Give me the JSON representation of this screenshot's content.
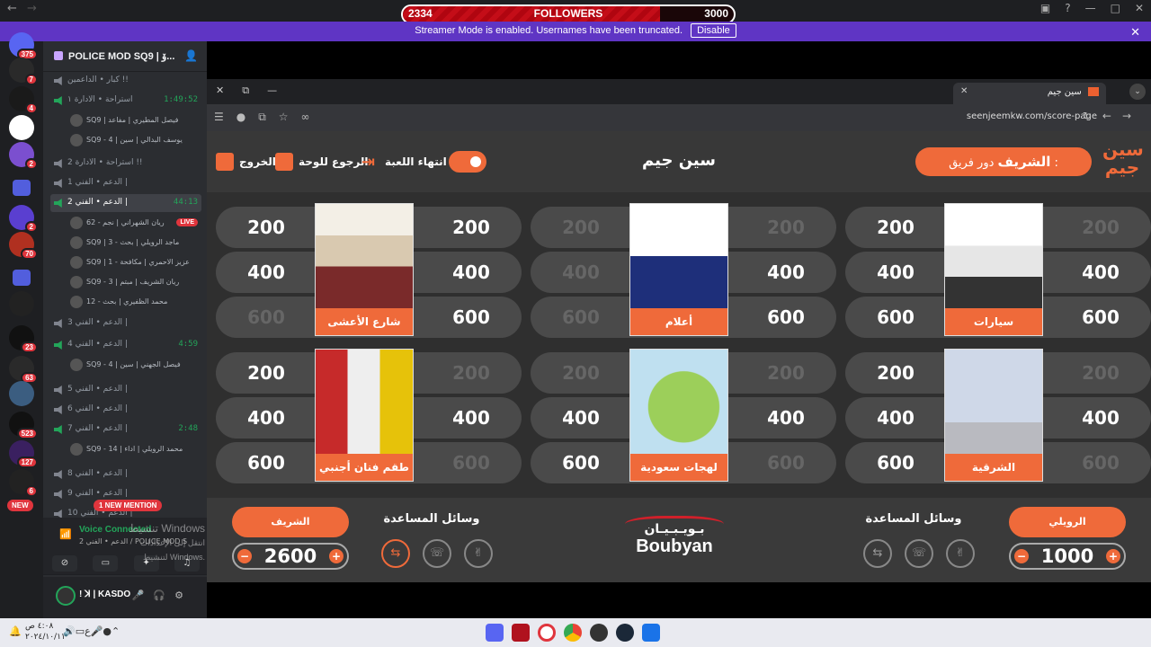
{
  "overlay": {
    "followers_label": "FOLLOWERS",
    "current": "2334",
    "goal": "3000",
    "progress": 0.778
  },
  "banner": {
    "text": "Streamer Mode is enabled. Usernames have been truncated.",
    "button": "Disable"
  },
  "rail": {
    "badges": [
      "375",
      "7",
      "4",
      "2",
      "2",
      "70",
      "23",
      "63",
      "523",
      "127",
      "6"
    ],
    "new_label": "NEW"
  },
  "discord": {
    "server_name": "POLICE MOD SQ9 | ۆ...",
    "channels": [
      {
        "name": "كبار • الداعمين !!",
        "icon": "lock-icon"
      },
      {
        "name": "استراحة • الادارة ١",
        "timer": "1:49:52",
        "active": true
      },
      {
        "name": "استراحة • الادارة 2 !!"
      },
      {
        "name": "الدعم • الفني 1 |"
      },
      {
        "name": "الدعم • الفني 2 |",
        "timer": "44:13",
        "active": true,
        "selected": true
      },
      {
        "name": "الدعم • الفني 3 |"
      },
      {
        "name": "الدعم • الفني 4 |",
        "timer": "4:59",
        "active": true
      },
      {
        "name": "الدعم • الفني 5 |"
      },
      {
        "name": "الدعم • الفني 6 |"
      },
      {
        "name": "الدعم • الفني 7 |",
        "timer": "2:48",
        "active": true
      },
      {
        "name": "الدعم • الفني 8 |"
      },
      {
        "name": "الدعم • الفني 9 |"
      },
      {
        "name": "الدعم • الفني 10 |"
      }
    ],
    "users": [
      "SQ9 | فيصل المطيري | مفاعد",
      "SQ9 - 4 | يوسف البدالي | سين",
      "62 - ريان الشهراني | نجم",
      "SQ9 | 3 - ماجد الرويلي | بحث",
      "SQ9 | 1 - عزيز الاحمري | مكافحة",
      "SQ9 - 3 | ريان الشريف | مبتم",
      "12 - محمد الظفيري | بحث",
      "SQ9 - 4 | فيصل الجهني | سين",
      "SQ9 - 14 | محمد الرويلي | اداء"
    ],
    "live_label": "LIVE",
    "mention": "1 NEW MENTION",
    "voice": {
      "status": "Voice Connected",
      "channel": "الدعم • الفني 2 / POLICE MOD S..."
    },
    "user": {
      "name": "! ꓘ | KASDO"
    },
    "activation": {
      "line1": "تنشيط Windows",
      "line2": "انتقل إلى الإعدادات لتنشيط Windows."
    }
  },
  "browser": {
    "tab_title": "سين جيم",
    "url": "seenjeemkw.com/score-page"
  },
  "game": {
    "title": "سين جيم",
    "logo": "سين جيم",
    "turn_prefix": "دور فريق :",
    "turn_team": "الشريف",
    "buttons": {
      "exit": "الخروج",
      "back": "الرجوع للوحة",
      "end": "انتهاء اللعبة"
    },
    "categories": [
      {
        "name": "شارع الأعشى",
        "values": [
          {
            "l": "200",
            "r": "200"
          },
          {
            "l": "400",
            "r": "400"
          },
          {
            "l": "600",
            "r": "600"
          }
        ],
        "used": [
          false,
          false,
          false,
          false,
          true,
          false
        ]
      },
      {
        "name": "أعلام",
        "values": [
          {
            "l": "200",
            "r": "200"
          },
          {
            "l": "400",
            "r": "400"
          },
          {
            "l": "600",
            "r": "600"
          }
        ],
        "used": [
          true,
          true,
          true,
          false,
          true,
          false
        ]
      },
      {
        "name": "سيارات",
        "values": [
          {
            "l": "200",
            "r": "200"
          },
          {
            "l": "400",
            "r": "400"
          },
          {
            "l": "600",
            "r": "600"
          }
        ],
        "used": [
          false,
          true,
          false,
          false,
          false,
          false
        ]
      },
      {
        "name": "طقم فنان أجنبي",
        "values": [
          {
            "l": "200",
            "r": "200"
          },
          {
            "l": "400",
            "r": "400"
          },
          {
            "l": "600",
            "r": "600"
          }
        ],
        "used": [
          false,
          true,
          false,
          false,
          false,
          true
        ]
      },
      {
        "name": "لهجات سعودية",
        "values": [
          {
            "l": "200",
            "r": "200"
          },
          {
            "l": "400",
            "r": "400"
          },
          {
            "l": "600",
            "r": "600"
          }
        ],
        "used": [
          true,
          true,
          false,
          false,
          false,
          true
        ]
      },
      {
        "name": "الشرقية",
        "values": [
          {
            "l": "200",
            "r": "200"
          },
          {
            "l": "400",
            "r": "400"
          },
          {
            "l": "600",
            "r": "600"
          }
        ],
        "used": [
          false,
          true,
          false,
          false,
          false,
          true
        ]
      }
    ],
    "teams": [
      {
        "name": "الشريف",
        "score": "2600",
        "helps_label": "وسائل المساعدة"
      },
      {
        "name": "الرويلي",
        "score": "1000",
        "helps_label": "وسائل المساعدة"
      }
    ],
    "sponsor": {
      "ar": "بـويـبـيـان",
      "en": "Boubyan"
    }
  },
  "taskbar": {
    "time": "٤:٠٨ ص",
    "date": "٢٠٢٤/١٠/١١",
    "lang": "ع"
  },
  "colors": {
    "accent": "#ef6a3a",
    "discord_green": "#23a55a",
    "banner": "#5f35c4"
  }
}
